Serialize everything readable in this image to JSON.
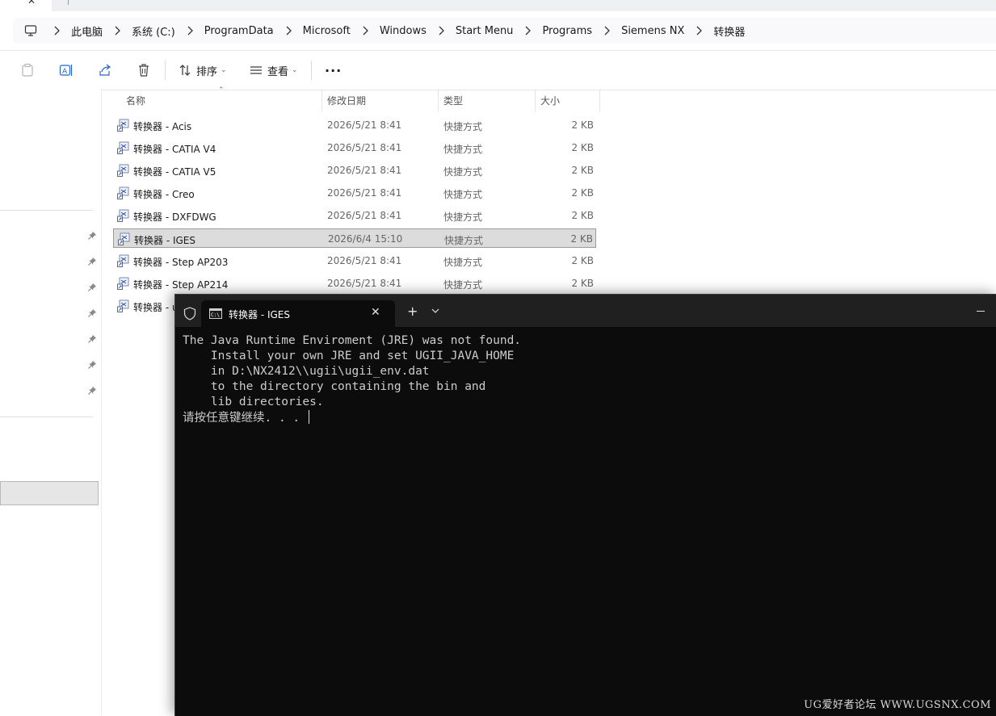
{
  "breadcrumb": [
    "此电脑",
    "系统 (C:)",
    "ProgramData",
    "Microsoft",
    "Windows",
    "Start Menu",
    "Programs",
    "Siemens NX",
    "转换器"
  ],
  "toolbar": {
    "sort_label": "排序",
    "view_label": "查看",
    "more_label": "···"
  },
  "columns": {
    "name": "名称",
    "date": "修改日期",
    "type": "类型",
    "size": "大小"
  },
  "files": [
    {
      "name": "转换器 - Acis",
      "date": "2026/5/21 8:41",
      "type": "快捷方式",
      "size": "2 KB"
    },
    {
      "name": "转换器 - CATIA V4",
      "date": "2026/5/21 8:41",
      "type": "快捷方式",
      "size": "2 KB"
    },
    {
      "name": "转换器 - CATIA V5",
      "date": "2026/5/21 8:41",
      "type": "快捷方式",
      "size": "2 KB"
    },
    {
      "name": "转换器 - Creo",
      "date": "2026/5/21 8:41",
      "type": "快捷方式",
      "size": "2 KB"
    },
    {
      "name": "转换器 - DXFDWG",
      "date": "2026/5/21 8:41",
      "type": "快捷方式",
      "size": "2 KB"
    },
    {
      "name": "转换器 - IGES",
      "date": "2026/6/4 15:10",
      "type": "快捷方式",
      "size": "2 KB"
    },
    {
      "name": "转换器 - Step AP203",
      "date": "2026/5/21 8:41",
      "type": "快捷方式",
      "size": "2 KB"
    },
    {
      "name": "转换器 - Step AP214",
      "date": "2026/5/21 8:41",
      "type": "快捷方式",
      "size": "2 KB"
    },
    {
      "name": "转换器 - u",
      "date": "",
      "type": "",
      "size": ""
    }
  ],
  "terminal": {
    "tab_title": "转换器 - IGES",
    "new_tab": "+",
    "close_glyph": "✕",
    "output": "The Java Runtime Enviroment (JRE) was not found.\n    Install your own JRE and set UGII_JAVA_HOME\n    in D:\\NX2412\\\\ugii\\ugii_env.dat\n    to the directory containing the bin and\n    lib directories.\n请按任意键继续. . . "
  },
  "watermark": "UG爱好者论坛 WWW.UGSNX.COM",
  "colors": {
    "selection": "#dcdcdc",
    "terminal_bg": "#0c0c0c",
    "titlebar_bg": "#202020"
  }
}
